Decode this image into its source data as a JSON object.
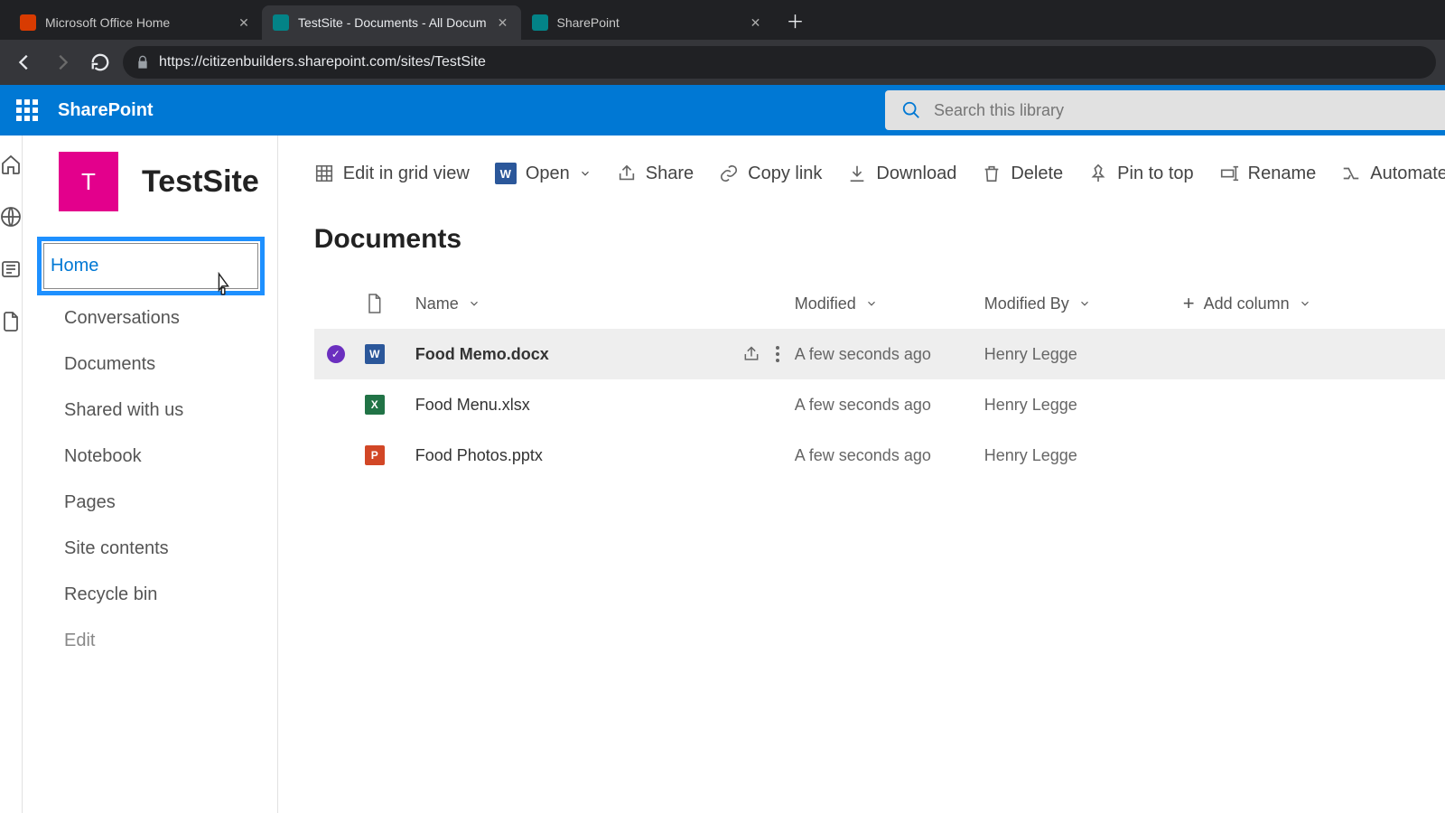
{
  "browser": {
    "tabs": [
      {
        "title": "Microsoft Office Home",
        "iconColor": "#d83b01"
      },
      {
        "title": "TestSite - Documents - All Docum",
        "iconColor": "#038387",
        "active": true
      },
      {
        "title": "SharePoint",
        "iconColor": "#038387"
      }
    ],
    "url": "https://citizenbuilders.sharepoint.com/sites/TestSite"
  },
  "suite": {
    "title": "SharePoint"
  },
  "search": {
    "placeholder": "Search this library"
  },
  "site": {
    "badge": "T",
    "title": "TestSite"
  },
  "leftNav": {
    "items": [
      "Home",
      "Conversations",
      "Documents",
      "Shared with us",
      "Notebook",
      "Pages",
      "Site contents",
      "Recycle bin"
    ],
    "edit": "Edit"
  },
  "commands": {
    "editGrid": "Edit in grid view",
    "open": "Open",
    "share": "Share",
    "copyLink": "Copy link",
    "download": "Download",
    "delete": "Delete",
    "pin": "Pin to top",
    "rename": "Rename",
    "automate": "Automate"
  },
  "section": {
    "title": "Documents"
  },
  "columns": {
    "name": "Name",
    "modified": "Modified",
    "modifiedBy": "Modified By",
    "add": "Add column"
  },
  "rows": [
    {
      "name": "Food Memo.docx",
      "modified": "A few seconds ago",
      "by": "Henry Legge",
      "type": "word",
      "selected": true
    },
    {
      "name": "Food Menu.xlsx",
      "modified": "A few seconds ago",
      "by": "Henry Legge",
      "type": "excel",
      "selected": false
    },
    {
      "name": "Food Photos.pptx",
      "modified": "A few seconds ago",
      "by": "Henry Legge",
      "type": "ppt",
      "selected": false
    }
  ]
}
